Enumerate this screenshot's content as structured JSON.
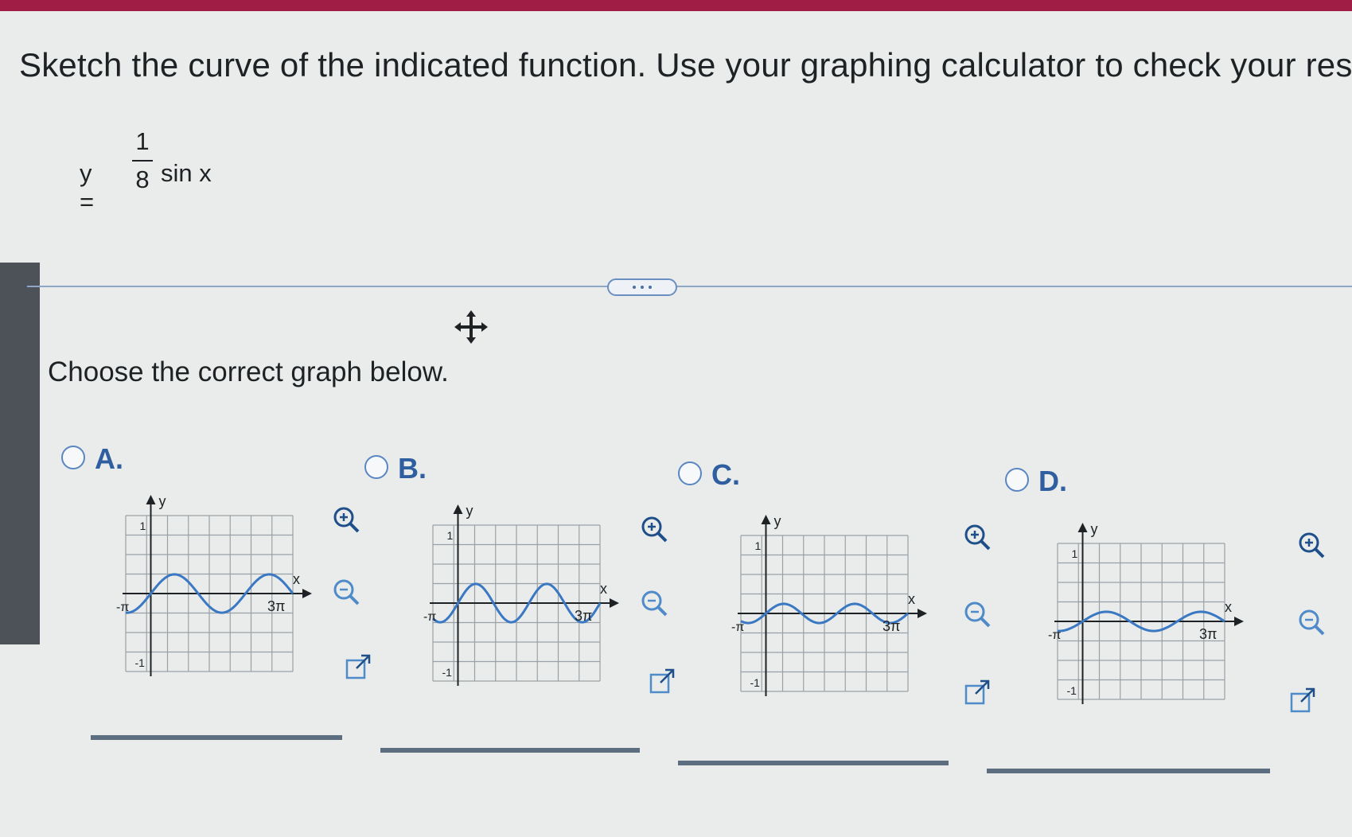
{
  "question": {
    "instruction": "Sketch the curve of the indicated function. Use your graphing calculator to check your results.",
    "formula_lhs": "y =",
    "formula_num": "1",
    "formula_den": "8",
    "formula_rhs": "sin x"
  },
  "prompt": "Choose the correct graph below.",
  "options": [
    {
      "label": "A.",
      "ylabel": "y",
      "xlabel": "x",
      "ytick_top": "1",
      "ytick_bottom": "-1",
      "xtick_left": "-π",
      "xtick_right": "3π",
      "selected": false
    },
    {
      "label": "B.",
      "ylabel": "y",
      "xlabel": "x",
      "ytick_top": "1",
      "ytick_bottom": "-1",
      "xtick_left": "-π",
      "xtick_right": "3π",
      "selected": false
    },
    {
      "label": "C.",
      "ylabel": "y",
      "xlabel": "x",
      "ytick_top": "1",
      "ytick_bottom": "-1",
      "xtick_left": "-π",
      "xtick_right": "3π",
      "selected": false
    },
    {
      "label": "D.",
      "ylabel": "y",
      "xlabel": "x",
      "ytick_top": "1",
      "ytick_bottom": "-1",
      "xtick_left": "-π",
      "xtick_right": "3π",
      "selected": false
    }
  ],
  "icons": [
    "zoom-in-icon",
    "zoom-out-icon",
    "popout-icon",
    "move-icon",
    "more-dots-icon"
  ],
  "colors": {
    "accent": "#2f5fa0",
    "curve": "#3a78c4",
    "brand_bar": "#a01e46"
  }
}
